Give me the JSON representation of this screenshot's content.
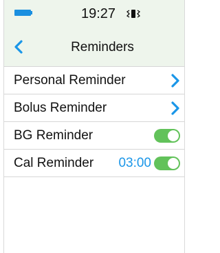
{
  "status_bar": {
    "time": "19:27",
    "battery_icon": "battery-icon",
    "vibrate_icon": "vibrate-icon"
  },
  "header": {
    "title": "Reminders",
    "back_icon": "chevron-left-icon"
  },
  "items": [
    {
      "label": "Personal Reminder",
      "control": "chevron"
    },
    {
      "label": "Bolus Reminder",
      "control": "chevron"
    },
    {
      "label": "BG Reminder",
      "control": "toggle",
      "on": true
    },
    {
      "label": "Cal Reminder",
      "control": "toggle",
      "on": true,
      "value": "03:00"
    }
  ],
  "colors": {
    "accent": "#1a96e8",
    "toggle_on": "#62c25a",
    "header_bg": "#eef5ec",
    "divider": "#d6d6d6"
  }
}
